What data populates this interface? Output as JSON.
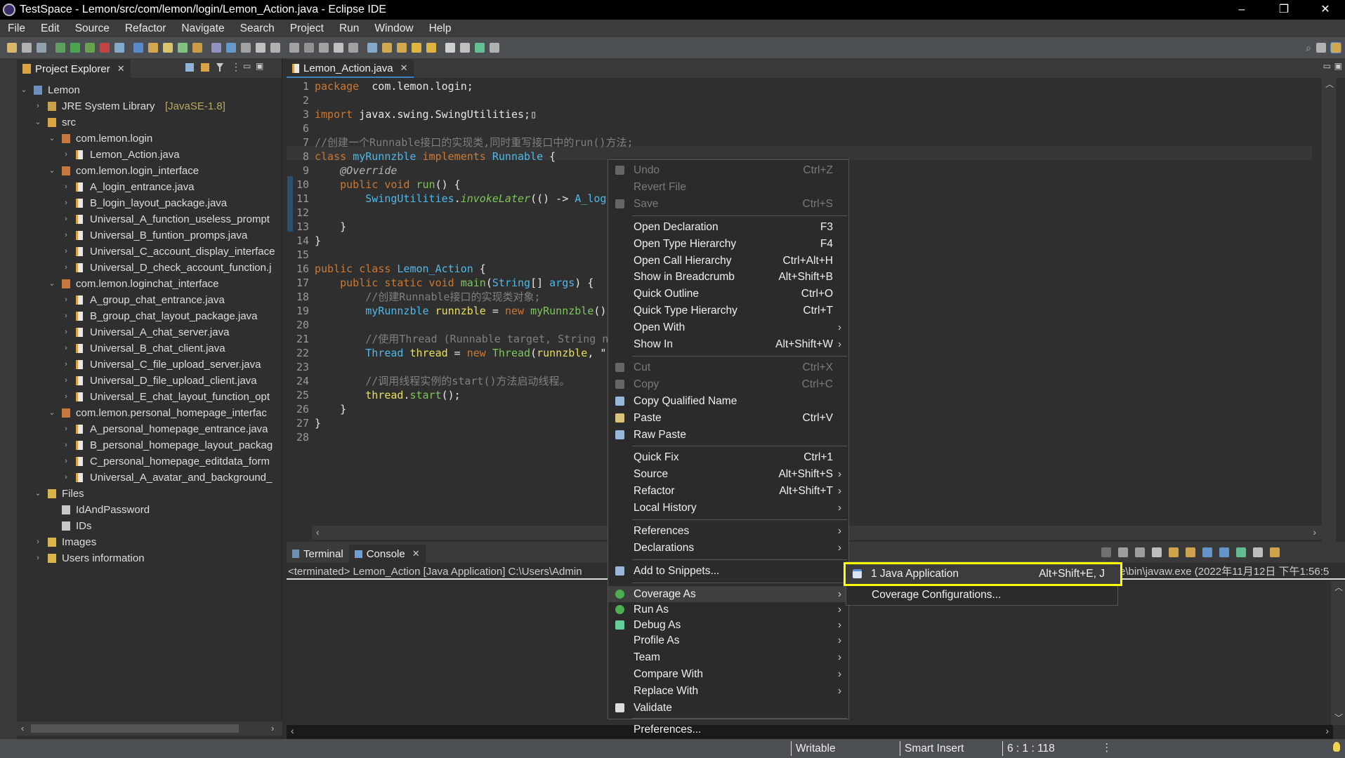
{
  "window": {
    "title": "TestSpace - Lemon/src/com/lemon/login/Lemon_Action.java - Eclipse IDE",
    "minimize": "–",
    "restore": "❐",
    "close": "✕"
  },
  "menubar": [
    "File",
    "Edit",
    "Source",
    "Refactor",
    "Navigate",
    "Search",
    "Project",
    "Run",
    "Window",
    "Help"
  ],
  "project_explorer": {
    "tab_label": "Project Explorer",
    "close": "✕",
    "tree": [
      {
        "label": "Lemon",
        "level": 0,
        "state": "expanded",
        "icon": "project-icon"
      },
      {
        "label": "JRE System Library",
        "suffix": " [JavaSE-1.8]",
        "level": 1,
        "state": "collapsed",
        "icon": "library-icon"
      },
      {
        "label": "src",
        "level": 1,
        "state": "expanded",
        "icon": "source-folder-icon"
      },
      {
        "label": "com.lemon.login",
        "level": 2,
        "state": "expanded",
        "icon": "package-icon"
      },
      {
        "label": "Lemon_Action.java",
        "level": 3,
        "state": "collapsed",
        "icon": "java-file-icon"
      },
      {
        "label": "com.lemon.login_interface",
        "level": 2,
        "state": "expanded",
        "icon": "package-icon"
      },
      {
        "label": "A_login_entrance.java",
        "level": 3,
        "state": "collapsed",
        "icon": "java-file-icon"
      },
      {
        "label": "B_login_layout_package.java",
        "level": 3,
        "state": "collapsed",
        "icon": "java-file-icon"
      },
      {
        "label": "Universal_A_function_useless_prompt",
        "level": 3,
        "state": "collapsed",
        "icon": "java-file-icon"
      },
      {
        "label": "Universal_B_funtion_promps.java",
        "level": 3,
        "state": "collapsed",
        "icon": "java-file-icon"
      },
      {
        "label": "Universal_C_account_display_interface",
        "level": 3,
        "state": "collapsed",
        "icon": "java-file-icon"
      },
      {
        "label": "Universal_D_check_account_function.j",
        "level": 3,
        "state": "collapsed",
        "icon": "java-file-icon"
      },
      {
        "label": "com.lemon.loginchat_interface",
        "level": 2,
        "state": "expanded",
        "icon": "package-icon"
      },
      {
        "label": "A_group_chat_entrance.java",
        "level": 3,
        "state": "collapsed",
        "icon": "java-file-icon"
      },
      {
        "label": "B_group_chat_layout_package.java",
        "level": 3,
        "state": "collapsed",
        "icon": "java-file-icon"
      },
      {
        "label": "Universal_A_chat_server.java",
        "level": 3,
        "state": "collapsed",
        "icon": "java-file-icon"
      },
      {
        "label": "Universal_B_chat_client.java",
        "level": 3,
        "state": "collapsed",
        "icon": "java-file-icon"
      },
      {
        "label": "Universal_C_file_upload_server.java",
        "level": 3,
        "state": "collapsed",
        "icon": "java-file-icon"
      },
      {
        "label": "Universal_D_file_upload_client.java",
        "level": 3,
        "state": "collapsed",
        "icon": "java-file-icon"
      },
      {
        "label": "Universal_E_chat_layout_function_opt",
        "level": 3,
        "state": "collapsed",
        "icon": "java-file-icon"
      },
      {
        "label": "com.lemon.personal_homepage_interfac",
        "level": 2,
        "state": "expanded",
        "icon": "package-icon"
      },
      {
        "label": "A_personal_homepage_entrance.java",
        "level": 3,
        "state": "collapsed",
        "icon": "java-file-icon"
      },
      {
        "label": "B_personal_homepage_layout_packag",
        "level": 3,
        "state": "collapsed",
        "icon": "java-file-icon"
      },
      {
        "label": "C_personal_homepage_editdata_form",
        "level": 3,
        "state": "collapsed",
        "icon": "java-file-icon"
      },
      {
        "label": "Universal_A_avatar_and_background_",
        "level": 3,
        "state": "collapsed",
        "icon": "java-file-icon"
      },
      {
        "label": "Files",
        "level": 1,
        "state": "expanded",
        "icon": "folder-icon"
      },
      {
        "label": "IdAndPassword",
        "level": 2,
        "state": "leaf",
        "icon": "file-icon"
      },
      {
        "label": "IDs",
        "level": 2,
        "state": "leaf",
        "icon": "file-icon"
      },
      {
        "label": "Images",
        "level": 1,
        "state": "collapsed",
        "icon": "folder-icon"
      },
      {
        "label": "Users information",
        "level": 1,
        "state": "collapsed",
        "icon": "folder-icon"
      }
    ]
  },
  "editor": {
    "tab_label": "Lemon_Action.java",
    "close": "✕",
    "lines": [
      {
        "n": "1",
        "t": [
          [
            "kw",
            "package"
          ],
          [
            "",
            "  com.lemon.login;"
          ]
        ]
      },
      {
        "n": "2",
        "t": []
      },
      {
        "n": "3",
        "t": [
          [
            "kw",
            "import"
          ],
          [
            "",
            " javax.swing.SwingUtilities;▯"
          ]
        ]
      },
      {
        "n": "6",
        "t": []
      },
      {
        "n": "7",
        "t": [
          [
            "cm",
            "//创建一个Runnable接口的实现类,同时重写接口中的run()方法;"
          ]
        ]
      },
      {
        "n": "8",
        "t": [
          [
            "kw",
            "class"
          ],
          [
            "",
            " "
          ],
          [
            "ty",
            "myRunnzble"
          ],
          [
            "",
            " "
          ],
          [
            "kw",
            "implements"
          ],
          [
            "",
            " "
          ],
          [
            "ty",
            "Runnable"
          ],
          [
            "",
            " {"
          ]
        ]
      },
      {
        "n": "9",
        "t": [
          [
            "",
            "    "
          ],
          [
            "an",
            "@Override"
          ]
        ]
      },
      {
        "n": "10",
        "t": [
          [
            "",
            "    "
          ],
          [
            "kw",
            "public void"
          ],
          [
            "",
            " "
          ],
          [
            "fn",
            "run"
          ],
          [
            "",
            "() {"
          ]
        ]
      },
      {
        "n": "11",
        "t": [
          [
            "",
            "        "
          ],
          [
            "ty",
            "SwingUtilities"
          ],
          [
            "",
            "."
          ],
          [
            "it",
            "invokeLater"
          ],
          [
            "",
            "(() -> "
          ],
          [
            "ty",
            "A_log"
          ]
        ]
      },
      {
        "n": "12",
        "t": []
      },
      {
        "n": "13",
        "t": [
          [
            "",
            "    }"
          ]
        ]
      },
      {
        "n": "14",
        "t": [
          [
            "",
            "}"
          ]
        ]
      },
      {
        "n": "15",
        "t": []
      },
      {
        "n": "16",
        "t": [
          [
            "kw",
            "public class"
          ],
          [
            "",
            " "
          ],
          [
            "ty",
            "Lemon_Action"
          ],
          [
            "",
            " {"
          ]
        ]
      },
      {
        "n": "17",
        "t": [
          [
            "",
            "    "
          ],
          [
            "kw",
            "public static void"
          ],
          [
            "",
            " "
          ],
          [
            "fn",
            "main"
          ],
          [
            "",
            "("
          ],
          [
            "ty",
            "String"
          ],
          [
            "",
            "[] "
          ],
          [
            "ty",
            "args"
          ],
          [
            "",
            ") {"
          ]
        ]
      },
      {
        "n": "18",
        "t": [
          [
            "",
            "        "
          ],
          [
            "cm",
            "//创建Runnable接口的实现类对象;"
          ]
        ]
      },
      {
        "n": "19",
        "t": [
          [
            "",
            "        "
          ],
          [
            "ty",
            "myRunnzble"
          ],
          [
            "",
            " "
          ],
          [
            "va",
            "runnzble"
          ],
          [
            "",
            " = "
          ],
          [
            "kw",
            "new"
          ],
          [
            "",
            " "
          ],
          [
            "fn",
            "myRunnzble"
          ],
          [
            "",
            "()"
          ]
        ]
      },
      {
        "n": "20",
        "t": []
      },
      {
        "n": "21",
        "t": [
          [
            "",
            "        "
          ],
          [
            "cm",
            "//使用Thread (Runnable target, String n"
          ]
        ]
      },
      {
        "n": "22",
        "t": [
          [
            "",
            "        "
          ],
          [
            "ty",
            "Thread"
          ],
          [
            "",
            " "
          ],
          [
            "va",
            "thread"
          ],
          [
            "",
            " = "
          ],
          [
            "kw",
            "new"
          ],
          [
            "",
            " "
          ],
          [
            "fn",
            "Thread"
          ],
          [
            "",
            "("
          ],
          [
            "va",
            "runnzble"
          ],
          [
            "",
            ", \""
          ]
        ]
      },
      {
        "n": "23",
        "t": []
      },
      {
        "n": "24",
        "t": [
          [
            "",
            "        "
          ],
          [
            "cm",
            "//调用线程实例的start()方法启动线程。"
          ]
        ]
      },
      {
        "n": "25",
        "t": [
          [
            "",
            "        "
          ],
          [
            "va",
            "thread"
          ],
          [
            "",
            "."
          ],
          [
            "fn",
            "start"
          ],
          [
            "",
            "();"
          ]
        ]
      },
      {
        "n": "26",
        "t": [
          [
            "",
            "    }"
          ]
        ]
      },
      {
        "n": "27",
        "t": [
          [
            "",
            "}"
          ]
        ]
      },
      {
        "n": "28",
        "t": []
      }
    ]
  },
  "console": {
    "tabs": [
      {
        "label": "Terminal",
        "active": false
      },
      {
        "label": "Console",
        "active": true
      }
    ],
    "close": "✕",
    "header_left": "<terminated> Lemon_Action [Java Application] C:\\Users\\Admin",
    "header_right": "e\\bin\\javaw.exe  (2022年11月12日 下午1:56:5"
  },
  "context_menu": [
    {
      "label": "Undo",
      "shortcut": "Ctrl+Z",
      "disabled": true,
      "icon": "undo-icon"
    },
    {
      "label": "Revert File",
      "disabled": true
    },
    {
      "label": "Save",
      "shortcut": "Ctrl+S",
      "disabled": true,
      "icon": "save-icon"
    },
    {
      "sep": true
    },
    {
      "label": "Open Declaration",
      "shortcut": "F3"
    },
    {
      "label": "Open Type Hierarchy",
      "shortcut": "F4"
    },
    {
      "label": "Open Call Hierarchy",
      "shortcut": "Ctrl+Alt+H"
    },
    {
      "label": "Show in Breadcrumb",
      "shortcut": "Alt+Shift+B"
    },
    {
      "label": "Quick Outline",
      "shortcut": "Ctrl+O"
    },
    {
      "label": "Quick Type Hierarchy",
      "shortcut": "Ctrl+T"
    },
    {
      "label": "Open With",
      "submenu": true
    },
    {
      "label": "Show In",
      "shortcut": "Alt+Shift+W",
      "submenu": true
    },
    {
      "sep": true
    },
    {
      "label": "Cut",
      "shortcut": "Ctrl+X",
      "disabled": true,
      "icon": "cut-icon"
    },
    {
      "label": "Copy",
      "shortcut": "Ctrl+C",
      "disabled": true,
      "icon": "copy-icon"
    },
    {
      "label": "Copy Qualified Name",
      "icon": "copy-qualified-name-icon"
    },
    {
      "label": "Paste",
      "shortcut": "Ctrl+V",
      "icon": "paste-icon"
    },
    {
      "label": "Raw Paste",
      "icon": "raw-paste-icon"
    },
    {
      "sep": true
    },
    {
      "label": "Quick Fix",
      "shortcut": "Ctrl+1"
    },
    {
      "label": "Source",
      "shortcut": "Alt+Shift+S",
      "submenu": true
    },
    {
      "label": "Refactor",
      "shortcut": "Alt+Shift+T",
      "submenu": true
    },
    {
      "label": "Local History",
      "submenu": true
    },
    {
      "sep": true
    },
    {
      "label": "References",
      "submenu": true
    },
    {
      "label": "Declarations",
      "submenu": true
    },
    {
      "sep": true
    },
    {
      "label": "Add to Snippets...",
      "icon": "snippets-icon"
    },
    {
      "sep": true
    },
    {
      "label": "Coverage As",
      "submenu": true,
      "highlighted": true,
      "icon": "coverage-icon"
    },
    {
      "label": "Run As",
      "submenu": true,
      "icon": "run-icon"
    },
    {
      "label": "Debug As",
      "submenu": true,
      "icon": "debug-icon"
    },
    {
      "label": "Profile As",
      "submenu": true
    },
    {
      "label": "Team",
      "submenu": true
    },
    {
      "label": "Compare With",
      "submenu": true
    },
    {
      "label": "Replace With",
      "submenu": true
    },
    {
      "label": "Validate",
      "icon": "checkmark-icon"
    },
    {
      "sep": true
    },
    {
      "label": "Preferences..."
    }
  ],
  "submenu": [
    {
      "label": "1 Java Application",
      "shortcut": "Alt+Shift+E, J",
      "highlighted": true,
      "icon": "java-application-icon"
    },
    {
      "label": "Coverage Configurations..."
    }
  ],
  "statusbar": {
    "writable": "Writable",
    "insert_mode": "Smart Insert",
    "position": "6 : 1 : 118"
  },
  "colors": {
    "highlight_border": "#ffff00",
    "keyword": "#cc7832",
    "type": "#4fb8e8",
    "method": "#7ec65b",
    "variable": "#e8e05a",
    "comment": "#808080"
  }
}
